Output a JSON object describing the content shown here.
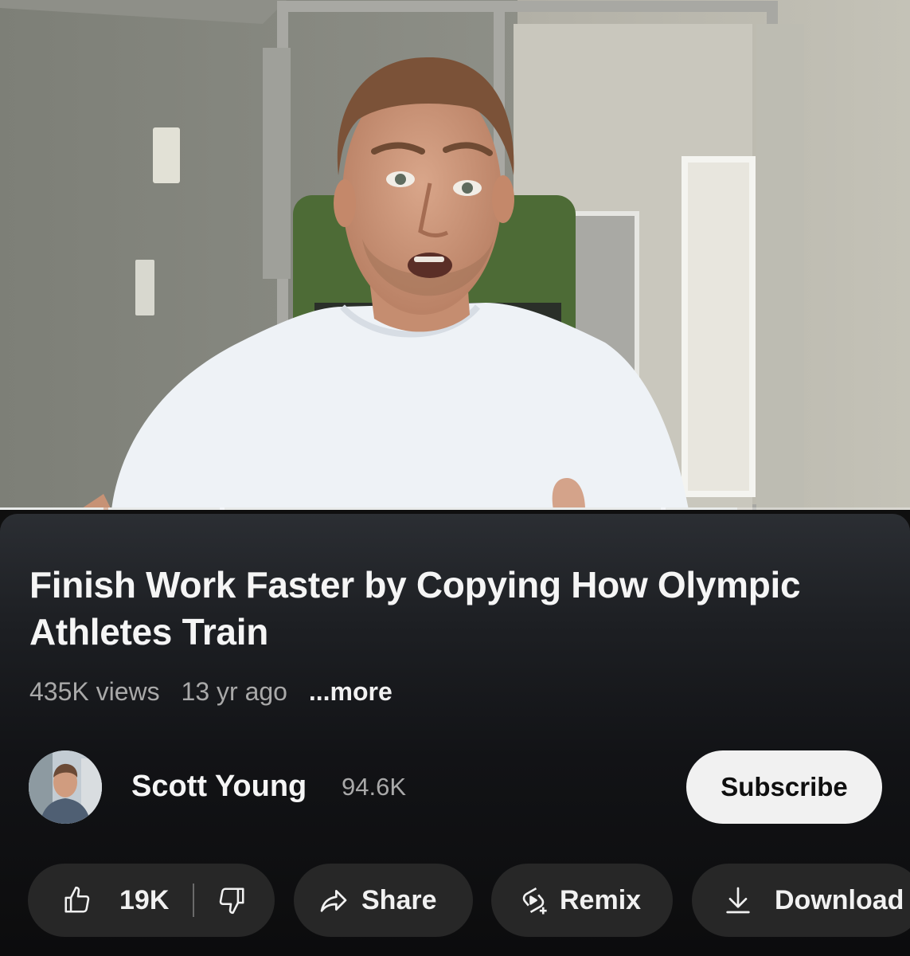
{
  "video": {
    "title": "Finish Work Faster by Copying How Olympic Athletes Train",
    "views": "435K views",
    "age": "13 yr ago",
    "more_label": "...more"
  },
  "channel": {
    "name": "Scott Young",
    "subscribers": "94.6K",
    "subscribe_label": "Subscribe"
  },
  "actions": {
    "likes": "19K",
    "share_label": "Share",
    "remix_label": "Remix",
    "download_label": "Download"
  },
  "icons": {
    "like": "thumbs-up-icon",
    "dislike": "thumbs-down-icon",
    "share": "share-arrow-icon",
    "remix": "remix-icon",
    "download": "download-icon"
  },
  "colors": {
    "background": "#0f0f0f",
    "pill": "#272727",
    "subscribe_bg": "#f1f1f1",
    "secondary_text": "#a9a9a9"
  }
}
